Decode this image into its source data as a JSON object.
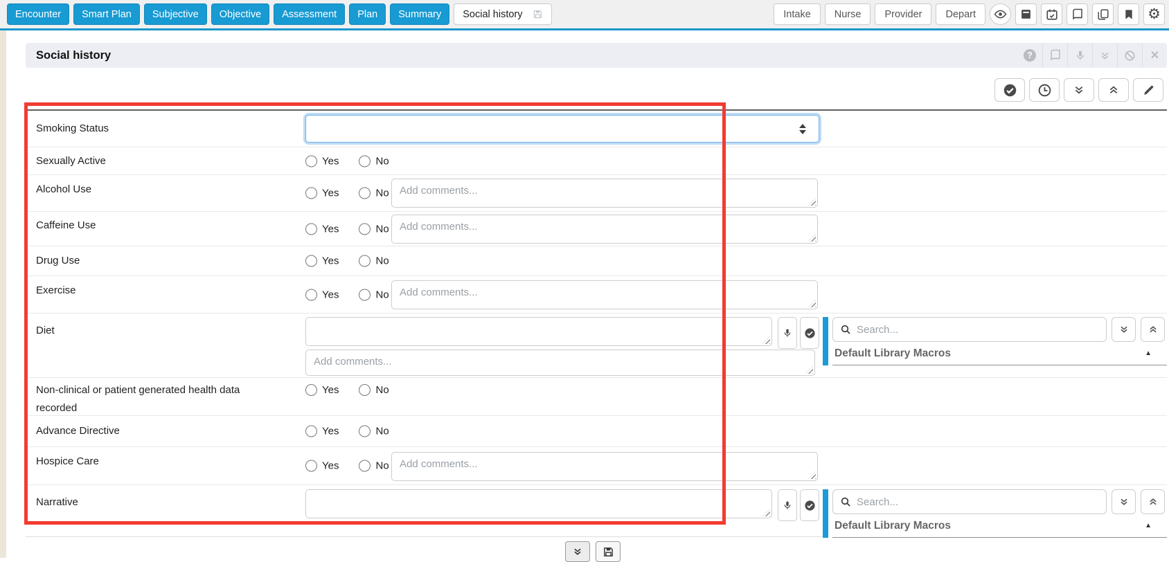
{
  "toolbar": {
    "tabs": [
      "Encounter",
      "Smart Plan",
      "Subjective",
      "Objective",
      "Assessment",
      "Plan",
      "Summary"
    ],
    "active_tab": "Social history",
    "stage_buttons": [
      "Intake",
      "Nurse",
      "Provider",
      "Depart"
    ],
    "icon_names": [
      "eye-icon",
      "archive-box-icon",
      "calendar-check-icon",
      "book-icon",
      "copy-icon",
      "bookmark-icon",
      "gear-icon"
    ]
  },
  "section": {
    "title": "Social history",
    "header_icon_names": [
      "help-icon",
      "book-icon",
      "microphone-icon",
      "chevron-double-down-icon",
      "block-icon",
      "close-icon"
    ],
    "action_icon_names": [
      "check-circle-icon",
      "clock-icon",
      "chevron-double-down-icon",
      "chevron-double-up-icon",
      "pencil-icon"
    ]
  },
  "form": {
    "yes_label": "Yes",
    "no_label": "No",
    "comment_placeholder": "Add comments...",
    "rows": [
      {
        "label": "Smoking Status",
        "type": "select",
        "value": ""
      },
      {
        "label": "Sexually Active",
        "type": "radio"
      },
      {
        "label": "Alcohol Use",
        "type": "radio_comment"
      },
      {
        "label": "Caffeine Use",
        "type": "radio_comment"
      },
      {
        "label": "Drug Use",
        "type": "radio"
      },
      {
        "label": "Exercise",
        "type": "radio_comment"
      },
      {
        "label": "Diet",
        "type": "text_comment",
        "value": ""
      },
      {
        "label": "Non-clinical or patient generated health data recorded",
        "type": "radio"
      },
      {
        "label": "Advance Directive",
        "type": "radio"
      },
      {
        "label": "Hospice Care",
        "type": "radio_comment"
      },
      {
        "label": "Narrative",
        "type": "text",
        "value": ""
      }
    ]
  },
  "macros_panel": {
    "search_placeholder": "Search...",
    "library_label": "Default Library Macros"
  },
  "icons": {
    "close": "✕",
    "gear": "⚙",
    "caret_up": "▲",
    "help": "?"
  },
  "colors": {
    "accent_blue": "#189ad3",
    "toolbar_border_blue": "#1a96cc",
    "macro_bar_blue": "#1a9cd8",
    "annotation_red": "#f23b30",
    "header_bg": "#eceef4",
    "left_strip": "#ece6d8"
  }
}
